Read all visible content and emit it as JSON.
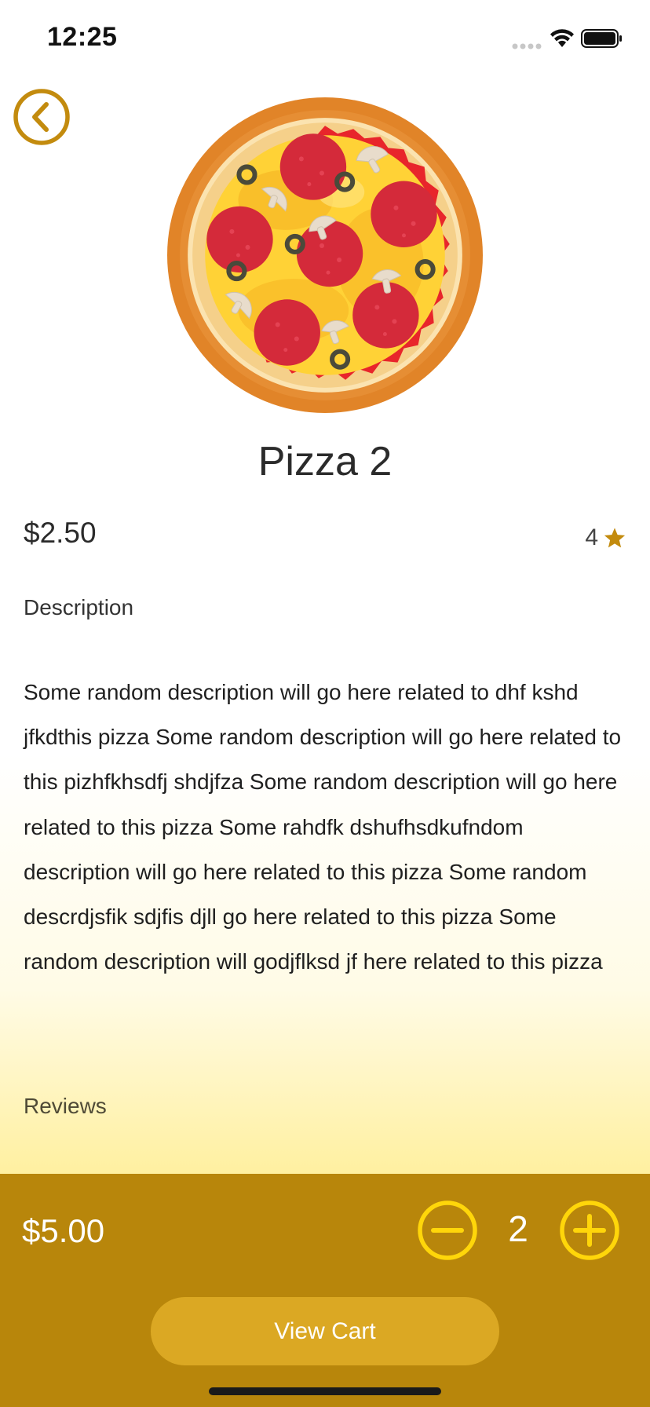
{
  "status_bar": {
    "time": "12:25"
  },
  "product": {
    "name": "Pizza 2",
    "price": "$2.50",
    "rating": "4",
    "description_label": "Description",
    "description": "Some random description will go here related to dhf kshd jfkdthis pizza Some random description will go here related to this pizhfkhsdfj shdjfza Some random description will go here related to this pizza Some rahdfk dshufhsdkufndom description will go here related to this pizza Some random descrdjsfik sdjfis djll go here related to this pizza Some random description will godjflksd jf here related to this pizza",
    "reviews_label": "Reviews"
  },
  "cart": {
    "total": "$5.00",
    "quantity": "2",
    "view_cart_label": "View Cart"
  },
  "icons": {
    "back": "chevron-left-circle-icon",
    "star": "star-icon",
    "minus": "minus-circle-icon",
    "plus": "plus-circle-icon"
  },
  "colors": {
    "accent": "#b8860b",
    "button": "#dba823",
    "quantity_icons": "#ffd60a",
    "star": "#c38b0e"
  }
}
